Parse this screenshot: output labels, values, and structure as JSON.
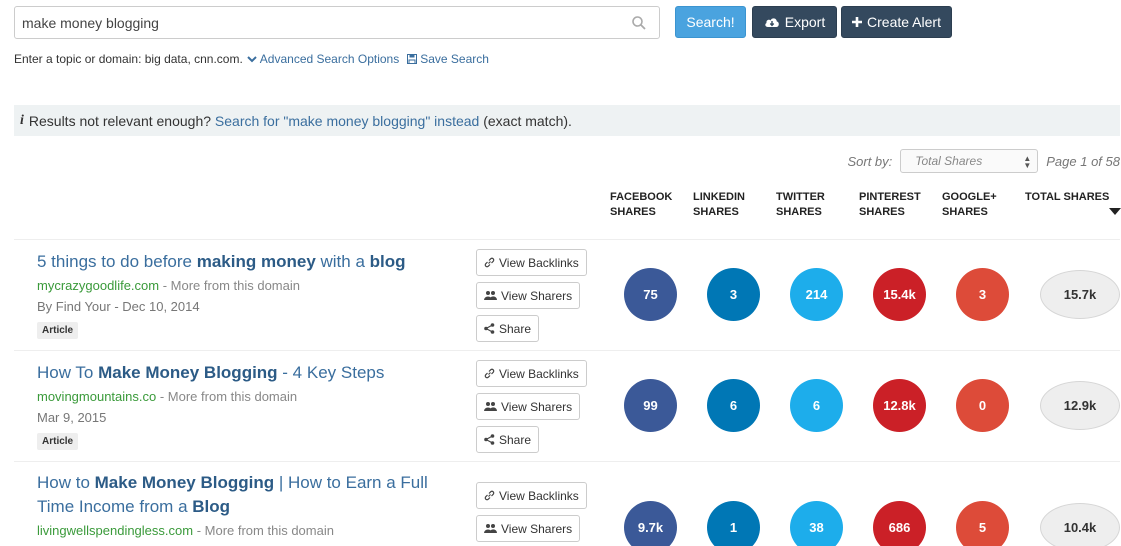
{
  "search": {
    "value": "make money blogging"
  },
  "buttons": {
    "search": "Search!",
    "export": "Export",
    "create_alert": "Create Alert"
  },
  "hint": {
    "text": "Enter a topic or domain: big data, cnn.com.",
    "advanced": "Advanced Search Options",
    "save": "Save Search"
  },
  "notice": {
    "prefix": "Results not relevant enough?",
    "link": "Search for \"make money blogging\" instead",
    "suffix": "(exact match)."
  },
  "sort": {
    "label": "Sort by:",
    "selected": "Total Shares",
    "page": "Page 1 of 58"
  },
  "columns": [
    {
      "line1": "FACEBOOK",
      "line2": "SHARES"
    },
    {
      "line1": "LINKEDIN",
      "line2": "SHARES"
    },
    {
      "line1": "TWITTER",
      "line2": "SHARES"
    },
    {
      "line1": "PINTEREST",
      "line2": "SHARES"
    },
    {
      "line1": "GOOGLE+",
      "line2": "SHARES"
    },
    {
      "line1": "TOTAL SHARES",
      "line2": ""
    }
  ],
  "actions": {
    "backlinks": "View Backlinks",
    "sharers": "View Sharers",
    "share": "Share"
  },
  "results": [
    {
      "title_parts": [
        "5 things to do before ",
        "making money",
        " with a ",
        "blog",
        ""
      ],
      "domain": "mycrazygoodlife.com",
      "more": " - More from this domain",
      "meta": "By Find Your - Dec 10, 2014",
      "tag": "Article",
      "shares": {
        "facebook": "75",
        "linkedin": "3",
        "twitter": "214",
        "pinterest": "15.4k",
        "googleplus": "3",
        "total": "15.7k"
      }
    },
    {
      "title_parts": [
        "How To ",
        "Make Money Blogging",
        " - 4 Key Steps",
        "",
        ""
      ],
      "domain": "movingmountains.co",
      "more": " - More from this domain",
      "meta": "Mar 9, 2015",
      "tag": "Article",
      "shares": {
        "facebook": "99",
        "linkedin": "6",
        "twitter": "6",
        "pinterest": "12.8k",
        "googleplus": "0",
        "total": "12.9k"
      }
    },
    {
      "title_parts": [
        "How to ",
        "Make Money Blogging",
        " | How to Earn a Full Time Income from a ",
        "Blog",
        ""
      ],
      "domain": "livingwellspendingless.com",
      "more": " - More from this domain",
      "meta": "",
      "tag": "",
      "shares": {
        "facebook": "9.7k",
        "linkedin": "1",
        "twitter": "38",
        "pinterest": "686",
        "googleplus": "5",
        "total": "10.4k"
      }
    }
  ]
}
